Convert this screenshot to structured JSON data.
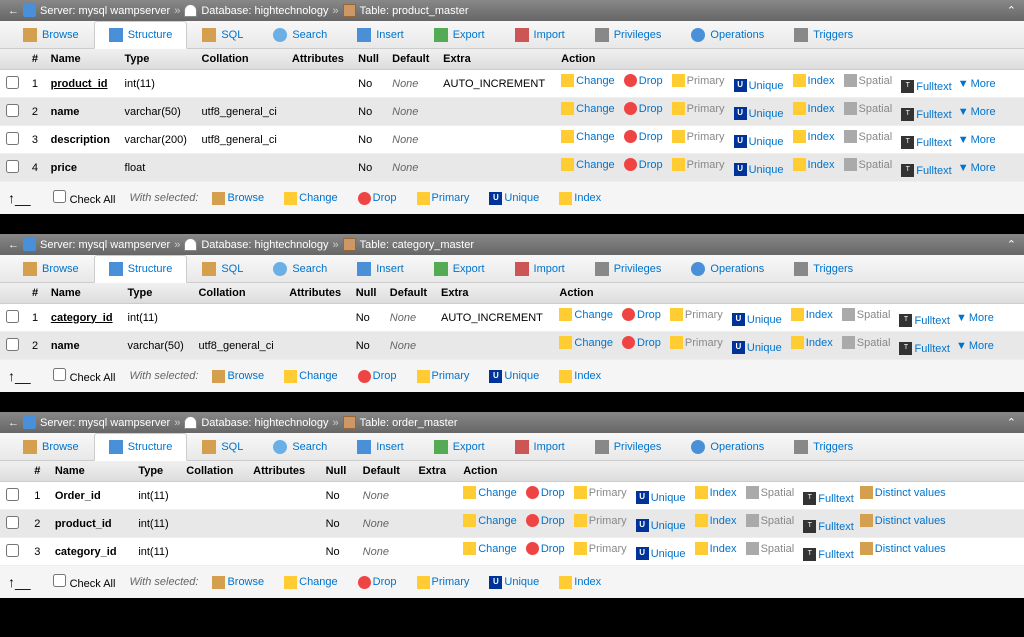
{
  "breadcrumb": {
    "server_label": "Server: mysql wampserver",
    "db_label": "Database: hightechnology",
    "sep": "»"
  },
  "tabs": [
    {
      "k": "browse",
      "label": "Browse"
    },
    {
      "k": "structure",
      "label": "Structure"
    },
    {
      "k": "sql",
      "label": "SQL"
    },
    {
      "k": "search",
      "label": "Search"
    },
    {
      "k": "insert",
      "label": "Insert"
    },
    {
      "k": "export",
      "label": "Export"
    },
    {
      "k": "import",
      "label": "Import"
    },
    {
      "k": "privileges",
      "label": "Privileges"
    },
    {
      "k": "operations",
      "label": "Operations"
    },
    {
      "k": "triggers",
      "label": "Triggers"
    }
  ],
  "headers": {
    "num": "#",
    "name": "Name",
    "type": "Type",
    "coll": "Collation",
    "attr": "Attributes",
    "null": "Null",
    "def": "Default",
    "extra": "Extra",
    "action": "Action"
  },
  "actions": {
    "change": "Change",
    "drop": "Drop",
    "primary": "Primary",
    "unique": "Unique",
    "index": "Index",
    "spatial": "Spatial",
    "fulltext": "Fulltext",
    "more": "More",
    "distinct": "Distinct values"
  },
  "footer": {
    "checkall": "Check All",
    "withsel": "With selected:",
    "browse": "Browse",
    "change": "Change",
    "drop": "Drop",
    "primary": "Primary",
    "unique": "Unique",
    "index": "Index"
  },
  "panels": [
    {
      "table": "Table: product_master",
      "compact": false,
      "rows": [
        {
          "n": "1",
          "name": "product_id",
          "u": true,
          "type": "int(11)",
          "coll": "",
          "null": "No",
          "def": "None",
          "extra": "AUTO_INCREMENT"
        },
        {
          "n": "2",
          "name": "name",
          "type": "varchar(50)",
          "coll": "utf8_general_ci",
          "null": "No",
          "def": "None",
          "extra": ""
        },
        {
          "n": "3",
          "name": "description",
          "type": "varchar(200)",
          "coll": "utf8_general_ci",
          "null": "No",
          "def": "None",
          "extra": ""
        },
        {
          "n": "4",
          "name": "price",
          "type": "float",
          "coll": "",
          "null": "No",
          "def": "None",
          "extra": ""
        }
      ]
    },
    {
      "table": "Table: category_master",
      "compact": false,
      "rows": [
        {
          "n": "1",
          "name": "category_id",
          "u": true,
          "type": "int(11)",
          "coll": "",
          "null": "No",
          "def": "None",
          "extra": "AUTO_INCREMENT"
        },
        {
          "n": "2",
          "name": "name",
          "type": "varchar(50)",
          "coll": "utf8_general_ci",
          "null": "No",
          "def": "None",
          "extra": ""
        }
      ]
    },
    {
      "table": "Table: order_master",
      "compact": true,
      "rows": [
        {
          "n": "1",
          "name": "Order_id",
          "type": "int(11)",
          "coll": "",
          "null": "No",
          "def": "None",
          "extra": ""
        },
        {
          "n": "2",
          "name": "product_id",
          "type": "int(11)",
          "coll": "",
          "null": "No",
          "def": "None",
          "extra": ""
        },
        {
          "n": "3",
          "name": "category_id",
          "type": "int(11)",
          "coll": "",
          "null": "No",
          "def": "None",
          "extra": ""
        }
      ]
    }
  ]
}
